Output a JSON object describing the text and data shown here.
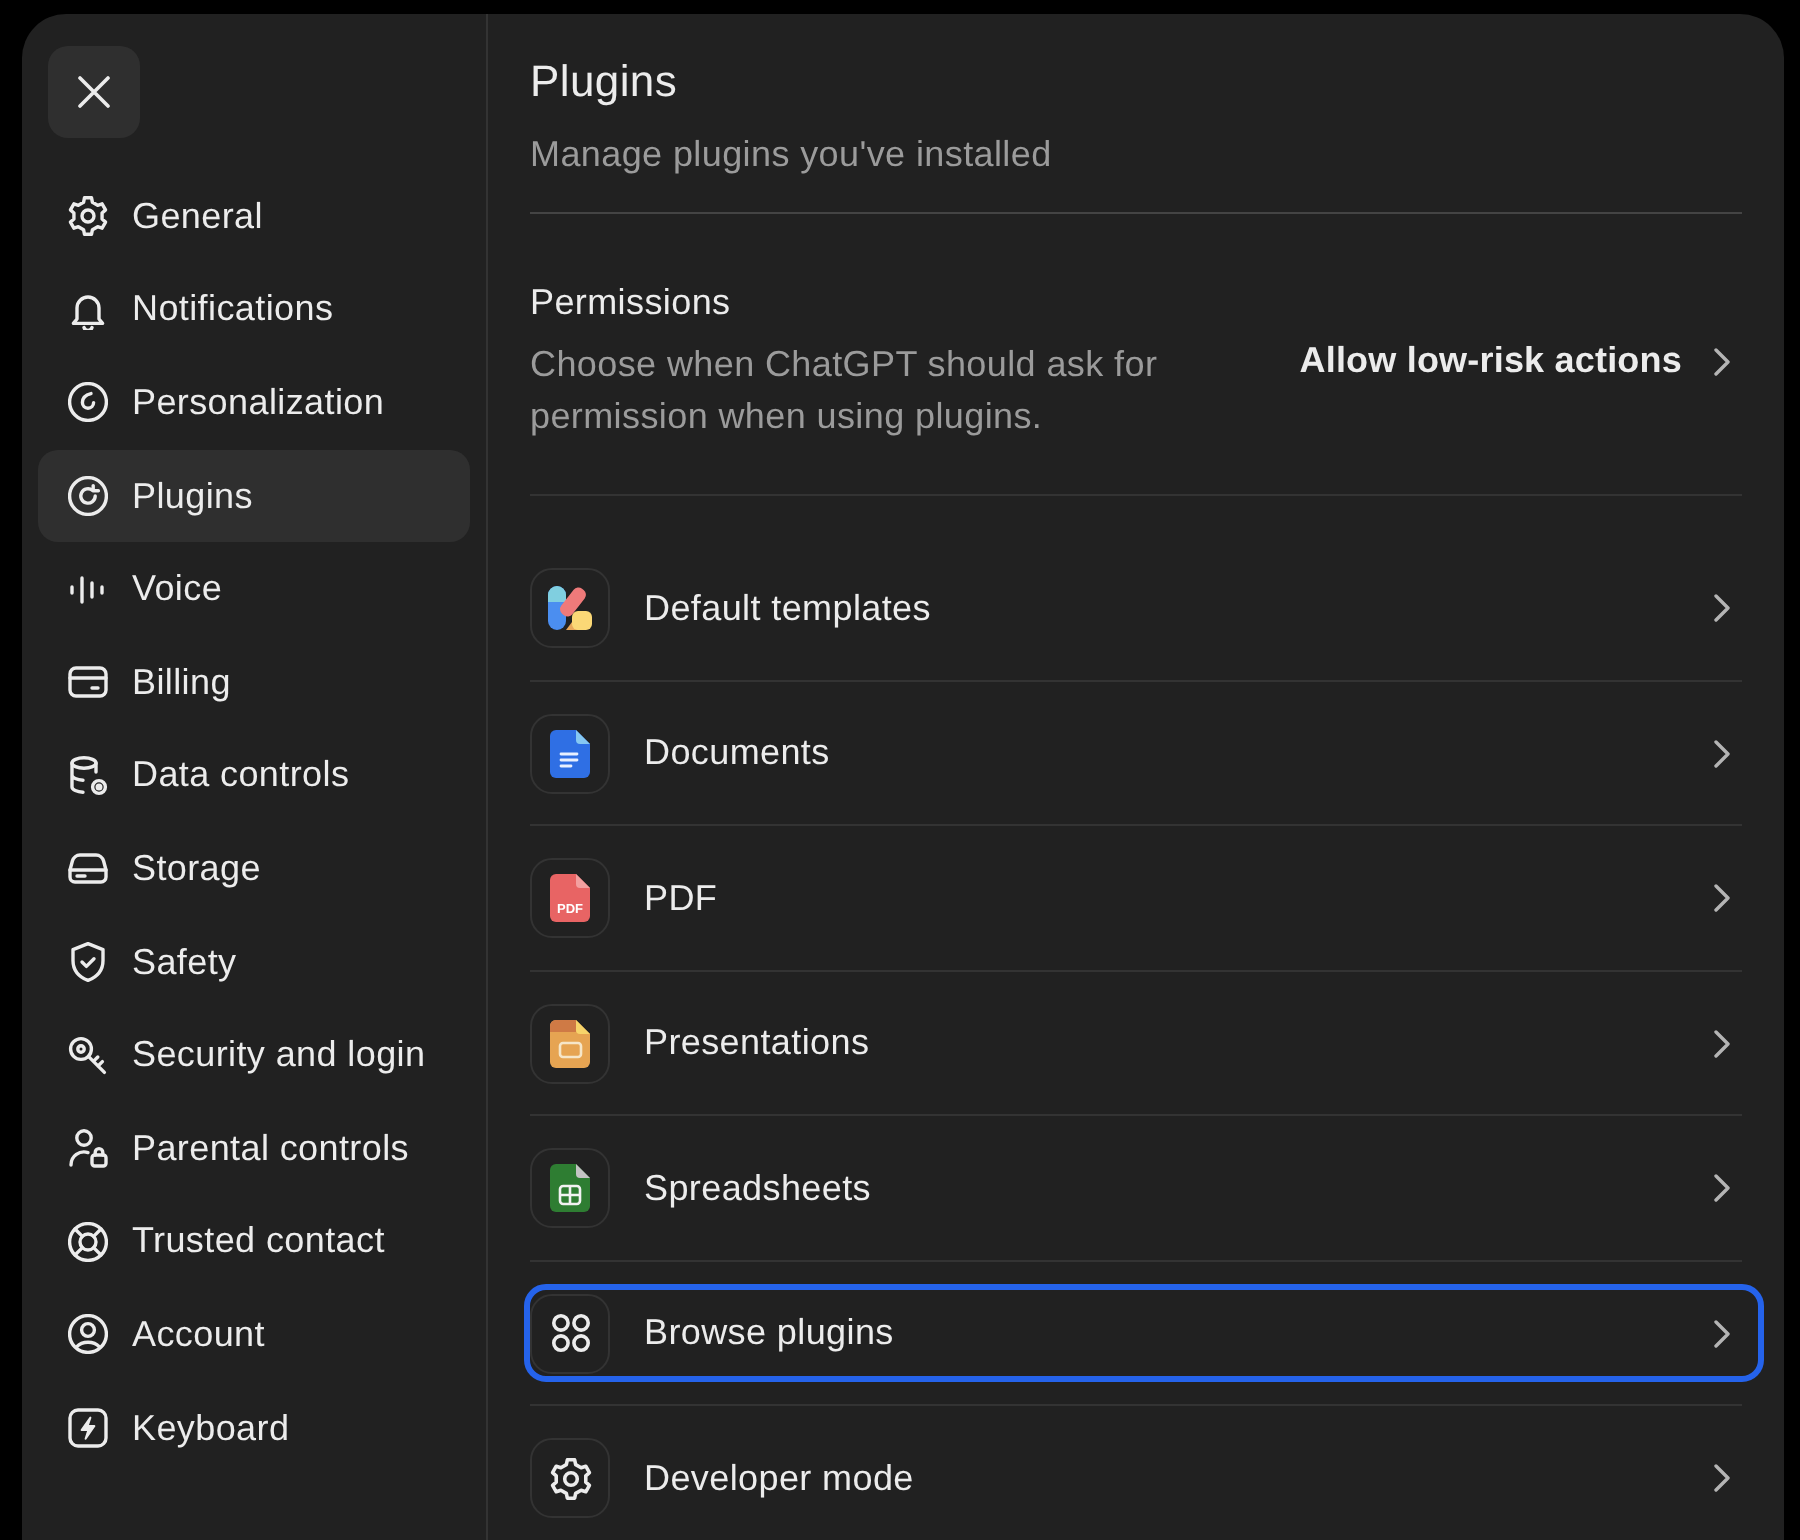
{
  "sidebar": {
    "items": [
      {
        "label": "General",
        "selected": false
      },
      {
        "label": "Notifications",
        "selected": false
      },
      {
        "label": "Personalization",
        "selected": false
      },
      {
        "label": "Plugins",
        "selected": true
      },
      {
        "label": "Voice",
        "selected": false
      },
      {
        "label": "Billing",
        "selected": false
      },
      {
        "label": "Data controls",
        "selected": false
      },
      {
        "label": "Storage",
        "selected": false
      },
      {
        "label": "Safety",
        "selected": false
      },
      {
        "label": "Security and login",
        "selected": false
      },
      {
        "label": "Parental controls",
        "selected": false
      },
      {
        "label": "Trusted contact",
        "selected": false
      },
      {
        "label": "Account",
        "selected": false
      },
      {
        "label": "Keyboard",
        "selected": false
      }
    ]
  },
  "header": {
    "title": "Plugins",
    "subtitle": "Manage plugins you've installed"
  },
  "permissions": {
    "title": "Permissions",
    "description": "Choose when ChatGPT should ask for permission when using plugins.",
    "value": "Allow low-risk actions"
  },
  "plugins": {
    "items": [
      {
        "label": "Default templates",
        "focused": false
      },
      {
        "label": "Documents",
        "focused": false
      },
      {
        "label": "PDF",
        "icon_label": "PDF",
        "focused": false
      },
      {
        "label": "Presentations",
        "focused": false
      },
      {
        "label": "Spreadsheets",
        "focused": false
      },
      {
        "label": "Browse plugins",
        "focused": true
      },
      {
        "label": "Developer mode",
        "focused": false
      }
    ]
  }
}
